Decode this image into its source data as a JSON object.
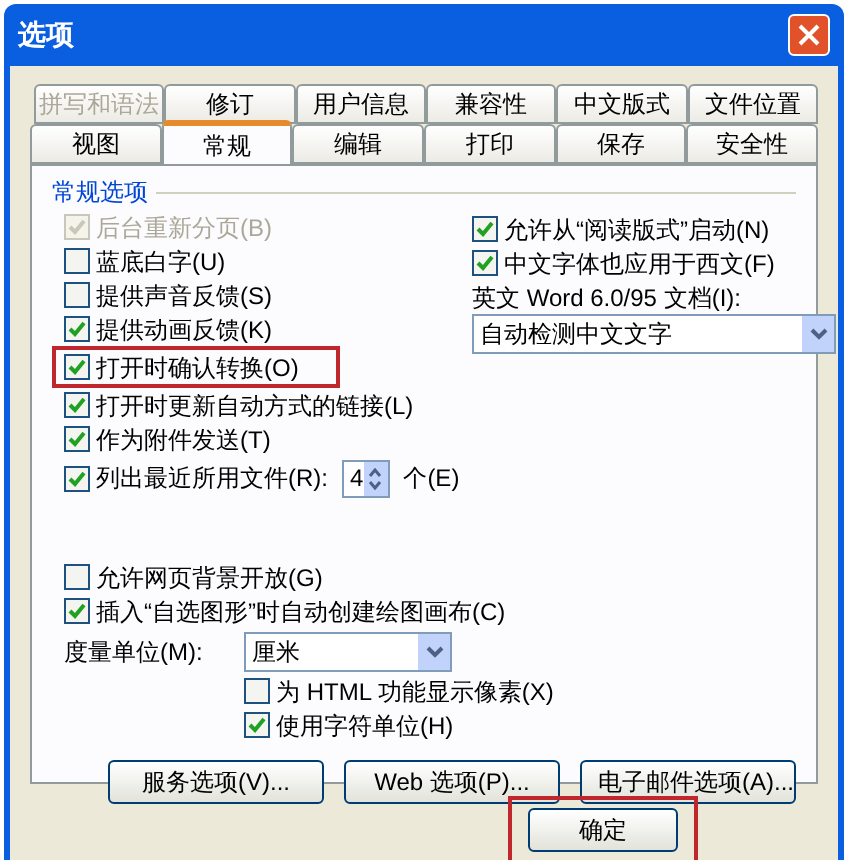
{
  "window": {
    "title": "选项"
  },
  "tab_rows": [
    [
      {
        "label": "拼写和语法",
        "selected": false,
        "disabled": true
      },
      {
        "label": "修订",
        "selected": false,
        "disabled": false
      },
      {
        "label": "用户信息",
        "selected": false,
        "disabled": false
      },
      {
        "label": "兼容性",
        "selected": false,
        "disabled": false
      },
      {
        "label": "中文版式",
        "selected": false,
        "disabled": false
      },
      {
        "label": "文件位置",
        "selected": false,
        "disabled": false
      }
    ],
    [
      {
        "label": "视图",
        "selected": false,
        "disabled": false
      },
      {
        "label": "常规",
        "selected": true,
        "disabled": false
      },
      {
        "label": "编辑",
        "selected": false,
        "disabled": false
      },
      {
        "label": "打印",
        "selected": false,
        "disabled": false
      },
      {
        "label": "保存",
        "selected": false,
        "disabled": false
      },
      {
        "label": "安全性",
        "selected": false,
        "disabled": false
      }
    ]
  ],
  "group_title": "常规选项",
  "left_options": [
    {
      "label": "后台重新分页(B)",
      "checked": true,
      "disabled": true,
      "highlighted": false
    },
    {
      "label": "蓝底白字(U)",
      "checked": false,
      "disabled": false,
      "highlighted": false
    },
    {
      "label": "提供声音反馈(S)",
      "checked": false,
      "disabled": false,
      "highlighted": false
    },
    {
      "label": "提供动画反馈(K)",
      "checked": true,
      "disabled": false,
      "highlighted": false
    },
    {
      "label": "打开时确认转换(O)",
      "checked": true,
      "disabled": false,
      "highlighted": true
    },
    {
      "label": "打开时更新自动方式的链接(L)",
      "checked": true,
      "disabled": false,
      "highlighted": false
    },
    {
      "label": "作为附件发送(T)",
      "checked": true,
      "disabled": false,
      "highlighted": false
    }
  ],
  "recent_files": {
    "label": "列出最近所用文件(R):",
    "checked": true,
    "value": "4",
    "unit": "个(E)"
  },
  "right_options": [
    {
      "label": "允许从“阅读版式”启动(N)",
      "checked": true
    },
    {
      "label": "中文字体也应用于西文(F)",
      "checked": true
    }
  ],
  "word95": {
    "label": "英文 Word 6.0/95 文档(I):",
    "value": "自动检测中文文字"
  },
  "lower_options": [
    {
      "label": "允许网页背景开放(G)",
      "checked": false
    },
    {
      "label": "插入“自选图形”时自动创建绘图画布(C)",
      "checked": true
    }
  ],
  "units": {
    "label": "度量单位(M):",
    "value": "厘米"
  },
  "unit_options": [
    {
      "label": "为 HTML 功能显示像素(X)",
      "checked": false
    },
    {
      "label": "使用字符单位(H)",
      "checked": true
    }
  ],
  "buttons": [
    {
      "label": "服务选项(V)..."
    },
    {
      "label": "Web 选项(P)..."
    },
    {
      "label": "电子邮件选项(A)..."
    }
  ],
  "footer_buttons": [
    {
      "label": "确定",
      "highlighted": true
    }
  ]
}
